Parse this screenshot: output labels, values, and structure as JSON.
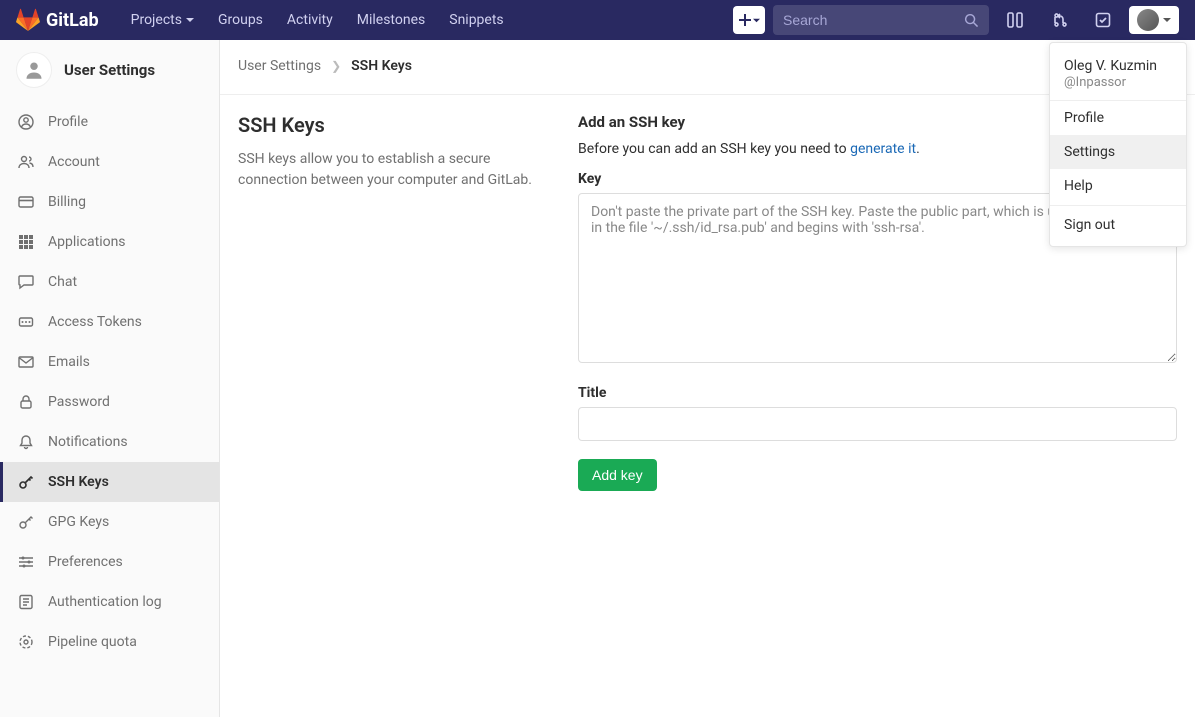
{
  "brand": {
    "name": "GitLab"
  },
  "nav": {
    "items": [
      {
        "label": "Projects",
        "caret": true
      },
      {
        "label": "Groups",
        "caret": false
      },
      {
        "label": "Activity",
        "caret": false
      },
      {
        "label": "Milestones",
        "caret": false
      },
      {
        "label": "Snippets",
        "caret": false
      }
    ],
    "search_placeholder": "Search"
  },
  "sidebar": {
    "title": "User Settings",
    "items": [
      {
        "icon": "profile",
        "label": "Profile",
        "active": false
      },
      {
        "icon": "account",
        "label": "Account",
        "active": false
      },
      {
        "icon": "billing",
        "label": "Billing",
        "active": false
      },
      {
        "icon": "applications",
        "label": "Applications",
        "active": false
      },
      {
        "icon": "chat",
        "label": "Chat",
        "active": false
      },
      {
        "icon": "token",
        "label": "Access Tokens",
        "active": false
      },
      {
        "icon": "emails",
        "label": "Emails",
        "active": false
      },
      {
        "icon": "password",
        "label": "Password",
        "active": false
      },
      {
        "icon": "notifications",
        "label": "Notifications",
        "active": false
      },
      {
        "icon": "sshkeys",
        "label": "SSH Keys",
        "active": true
      },
      {
        "icon": "gpgkeys",
        "label": "GPG Keys",
        "active": false
      },
      {
        "icon": "preferences",
        "label": "Preferences",
        "active": false
      },
      {
        "icon": "authlog",
        "label": "Authentication log",
        "active": false
      },
      {
        "icon": "pipeline",
        "label": "Pipeline quota",
        "active": false
      }
    ]
  },
  "breadcrumb": {
    "parent": "User Settings",
    "current": "SSH Keys"
  },
  "page": {
    "title": "SSH Keys",
    "description": "SSH keys allow you to establish a secure connection between your computer and GitLab.",
    "form": {
      "heading": "Add an SSH key",
      "intro_prefix": "Before you can add an SSH key you need to ",
      "intro_link": "generate it",
      "intro_suffix": ".",
      "key_label": "Key",
      "key_placeholder": "Don't paste the private part of the SSH key. Paste the public part, which is usually contained in the file '~/.ssh/id_rsa.pub' and begins with 'ssh-rsa'.",
      "title_label": "Title",
      "submit_label": "Add key"
    }
  },
  "user_menu": {
    "name": "Oleg V. Kuzmin",
    "handle": "@Inpassor",
    "items": [
      {
        "label": "Profile",
        "hover": false
      },
      {
        "label": "Settings",
        "hover": true
      },
      {
        "label": "Help",
        "hover": false
      }
    ],
    "signout": "Sign out"
  },
  "colors": {
    "navbar": "#292961",
    "accent": "#1aaa55",
    "link": "#1b69b6"
  }
}
